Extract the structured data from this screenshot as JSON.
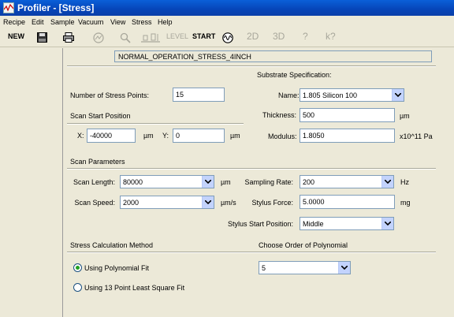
{
  "window": {
    "title": "Profiler - [Stress]"
  },
  "menu": [
    "Recipe",
    "Edit",
    "Sample",
    "Vacuum",
    "View",
    "Stress",
    "Help"
  ],
  "toolbar": {
    "new_label": "NEW",
    "level_label": "LEVEL",
    "start_label": "START",
    "view2d_label": "2D",
    "view3d_label": "3D",
    "help_glyph": "?",
    "whatsthis_glyph": "k?"
  },
  "recipe_name": "NORMAL_OPERATION_STRESS_4INCH",
  "stress_points": {
    "label": "Number of Stress Points:",
    "value": "15"
  },
  "scan_start": {
    "heading": "Scan Start Position",
    "x_label": "X:",
    "x_value": "-40000",
    "x_unit": "µm",
    "y_label": "Y:",
    "y_value": "0",
    "y_unit": "µm"
  },
  "substrate": {
    "heading": "Substrate Specification:",
    "name_label": "Name:",
    "name_value": "1.805 Silicon 100",
    "thickness_label": "Thickness:",
    "thickness_value": "500",
    "thickness_unit": "µm",
    "modulus_label": "Modulus:",
    "modulus_value": "1.8050",
    "modulus_unit": "x10^11 Pa"
  },
  "scan_params": {
    "heading": "Scan Parameters",
    "length_label": "Scan Length:",
    "length_value": "80000",
    "length_unit": "µm",
    "speed_label": "Scan Speed:",
    "speed_value": "2000",
    "speed_unit": "µm/s",
    "sampling_label": "Sampling Rate:",
    "sampling_value": "200",
    "sampling_unit": "Hz",
    "force_label": "Stylus Force:",
    "force_value": "5.0000",
    "force_unit": "mg",
    "start_pos_label": "Stylus Start Position:",
    "start_pos_value": "Middle"
  },
  "stress_calc": {
    "heading": "Stress Calculation Method",
    "option1": "Using Polynomial Fit",
    "option2": "Using 13 Point Least Square Fit",
    "selected": "option1"
  },
  "poly_order": {
    "heading": "Choose Order of Polynomial",
    "value": "5"
  }
}
